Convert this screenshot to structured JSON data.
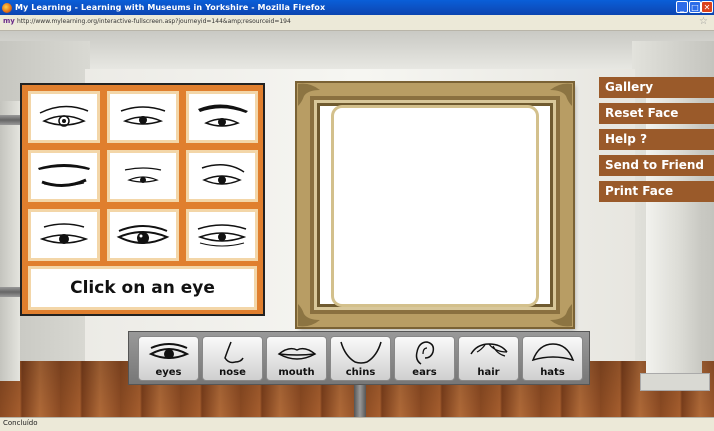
{
  "window": {
    "title": "My Learning - Learning with Museums in Yorkshire - Mozilla Firefox",
    "min_glyph": "_",
    "max_glyph": "□",
    "close_glyph": "✕"
  },
  "addressbar": {
    "site_label": "my",
    "url": "http://www.mylearning.org/interactive-fullscreen.asp?journeyid=144&amp;resourceid=194",
    "star": "☆"
  },
  "panel": {
    "prompt": "Click on an eye",
    "eye_count": 9
  },
  "menu": {
    "items": [
      "Gallery",
      "Reset Face",
      "Help ?",
      "Send to Friend",
      "Print Face"
    ]
  },
  "tools": {
    "items": [
      "eyes",
      "nose",
      "mouth",
      "chins",
      "ears",
      "hair",
      "hats"
    ]
  },
  "statusbar": {
    "text": "Concluído"
  },
  "colors": {
    "menu_bg": "#9a5a2a",
    "panel_bg": "#e07f2e",
    "frame_gold": "#b89d64"
  }
}
